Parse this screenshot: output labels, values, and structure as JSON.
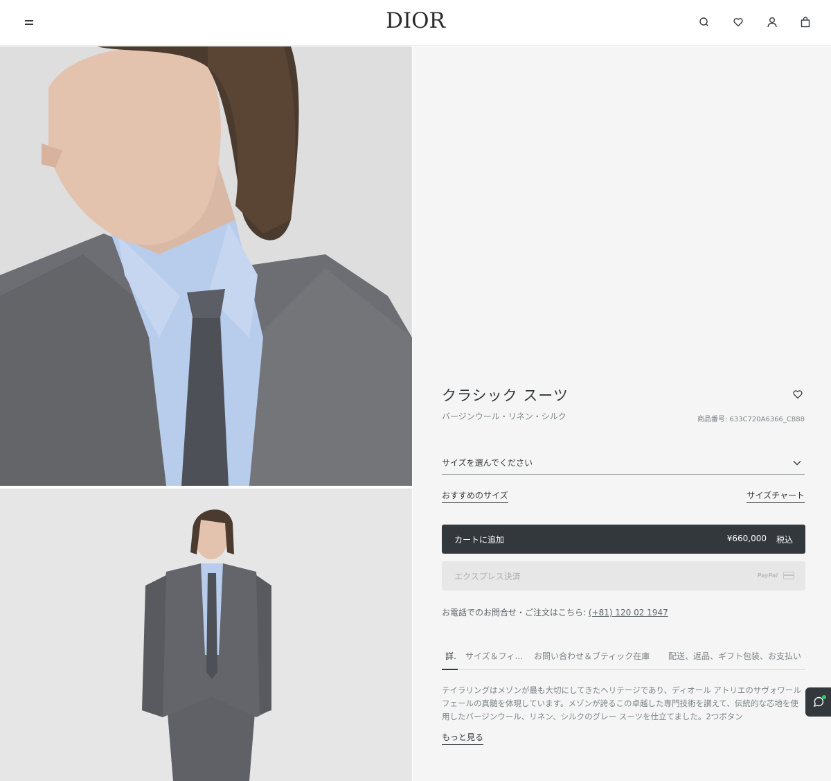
{
  "header": {
    "logo": "DIOR",
    "icons": [
      "menu-icon",
      "search-icon",
      "heart-icon",
      "user-icon",
      "bag-icon"
    ]
  },
  "product": {
    "title": "クラシック スーツ",
    "subtitle": "バージンウール・リネン・シルク",
    "reference": "商品番号: 633C720A6366_C888",
    "size_select_label": "サイズを選んでください",
    "recommended_size_link": "おすすめのサイズ",
    "size_chart_link": "サイズチャート",
    "add_to_cart": {
      "label": "カートに追加",
      "price": "¥660,000",
      "tax": "税込"
    },
    "express_checkout": {
      "label": "エクスプレス決済",
      "paypal": "PayPal"
    },
    "phone": {
      "text": "お電話でのお問合せ・ご注文はこちら: ",
      "number": "(+81) 120 02 1947"
    },
    "tabs": [
      "詳細",
      "サイズ＆フィット",
      "お問い合わせ＆ブティック在庫",
      "配送、返品、ギフト包装、お支払い"
    ],
    "description": "テイラリングはメゾンが最も大切にしてきたヘリテージであり、ディオール アトリエのサヴォワールフェールの真髄を体現しています。メゾンが誇るこの卓越した専門技術を讃えて、伝統的な芯地を使用したバージンウール、リネン、シルクのグレー スーツを仕立てました。2つボタン",
    "more_link": "もっと見る"
  },
  "colors": {
    "dark": "#33383c",
    "panel_bg": "#f5f5f5",
    "suit_gray": "#6d6f74",
    "shirt_blue": "#b8ccec"
  }
}
